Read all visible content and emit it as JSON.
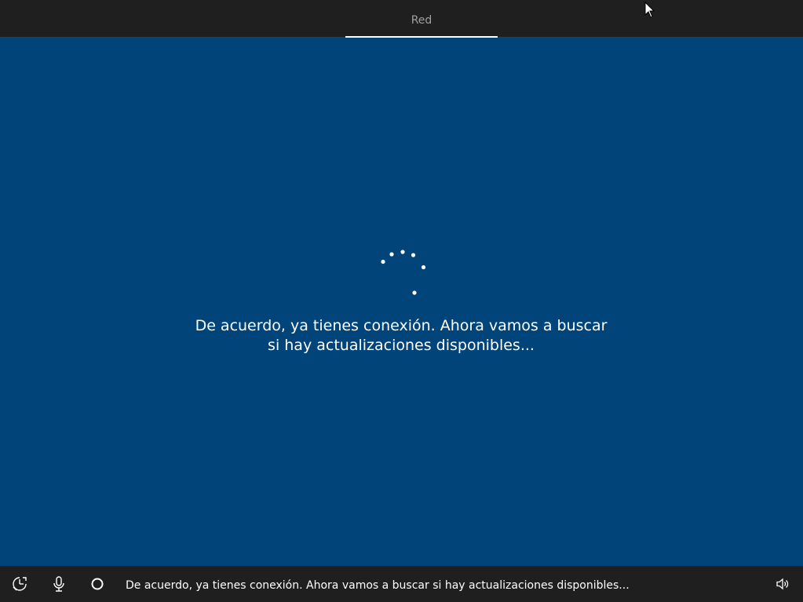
{
  "header": {
    "active_step_label": "Red"
  },
  "main": {
    "message_line1": "De acuerdo, ya tienes conexión. Ahora vamos a buscar",
    "message_line2": "si hay actualizaciones disponibles..."
  },
  "taskbar": {
    "ease_of_access_icon": "ease-of-access-icon",
    "microphone_icon": "microphone-icon",
    "cortana_icon": "cortana-icon",
    "caption": "De acuerdo, ya tienes conexión. Ahora vamos a buscar si hay actualizaciones disponibles...",
    "volume_icon": "volume-icon"
  },
  "colors": {
    "background": "#00447a",
    "bar": "#1f1f1f",
    "text": "#ffffff",
    "tab_text": "#a0a0a0"
  }
}
